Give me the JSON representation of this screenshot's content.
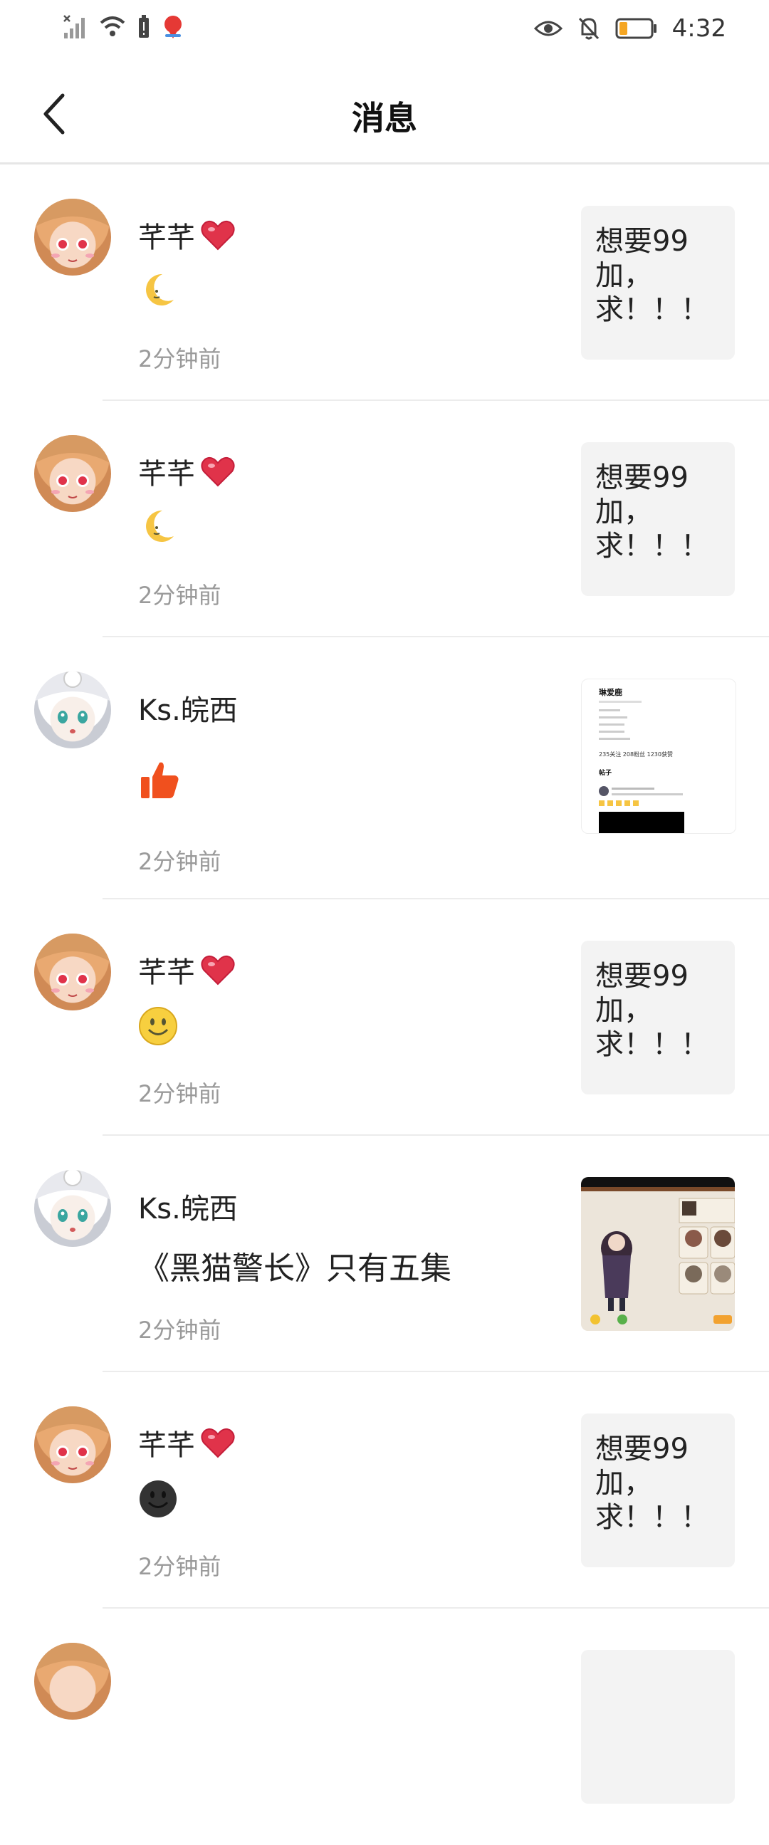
{
  "status_bar": {
    "time": "4:32"
  },
  "header": {
    "title": "消息"
  },
  "messages": [
    {
      "name": "芊芊",
      "content": "",
      "content_icon": "crescent-moon-emoji",
      "time": "2分钟前",
      "thumb_text": "想要99加，求！！！",
      "avatar": "anime-girl-orange-hair"
    },
    {
      "name": "芊芊",
      "content": "",
      "content_icon": "crescent-moon-emoji",
      "time": "2分钟前",
      "thumb_text": "想要99加，求！！！",
      "avatar": "anime-girl-orange-hair"
    },
    {
      "name": "Ks.皖西",
      "content": "",
      "content_icon": "thumbs-up-icon",
      "time": "2分钟前",
      "thumb_text": "",
      "thumb_kind": "profile-screenshot",
      "avatar": "anime-girl-white-hair"
    },
    {
      "name": "芊芊",
      "content": "",
      "content_icon": "smiley-emoji",
      "time": "2分钟前",
      "thumb_text": "想要99加，求！！！",
      "avatar": "anime-girl-orange-hair"
    },
    {
      "name": "Ks.皖西",
      "content": "《黑猫警长》只有五集",
      "content_icon": "",
      "time": "2分钟前",
      "thumb_text": "",
      "thumb_kind": "game-screenshot",
      "avatar": "anime-girl-white-hair"
    },
    {
      "name": "芊芊",
      "content": "",
      "content_icon": "dark-smiley-emoji",
      "time": "2分钟前",
      "thumb_text": "想要99加，求！！！",
      "avatar": "anime-girl-orange-hair"
    }
  ],
  "thumb_profile": {
    "title": "琳爱鹿",
    "stats": "235关注 208粉丝 1230获赞",
    "tab": "帖子"
  },
  "colors": {
    "accent_red": "#e0334a",
    "thumb_bg": "#f3f3f3",
    "like_orange": "#f0501e"
  }
}
